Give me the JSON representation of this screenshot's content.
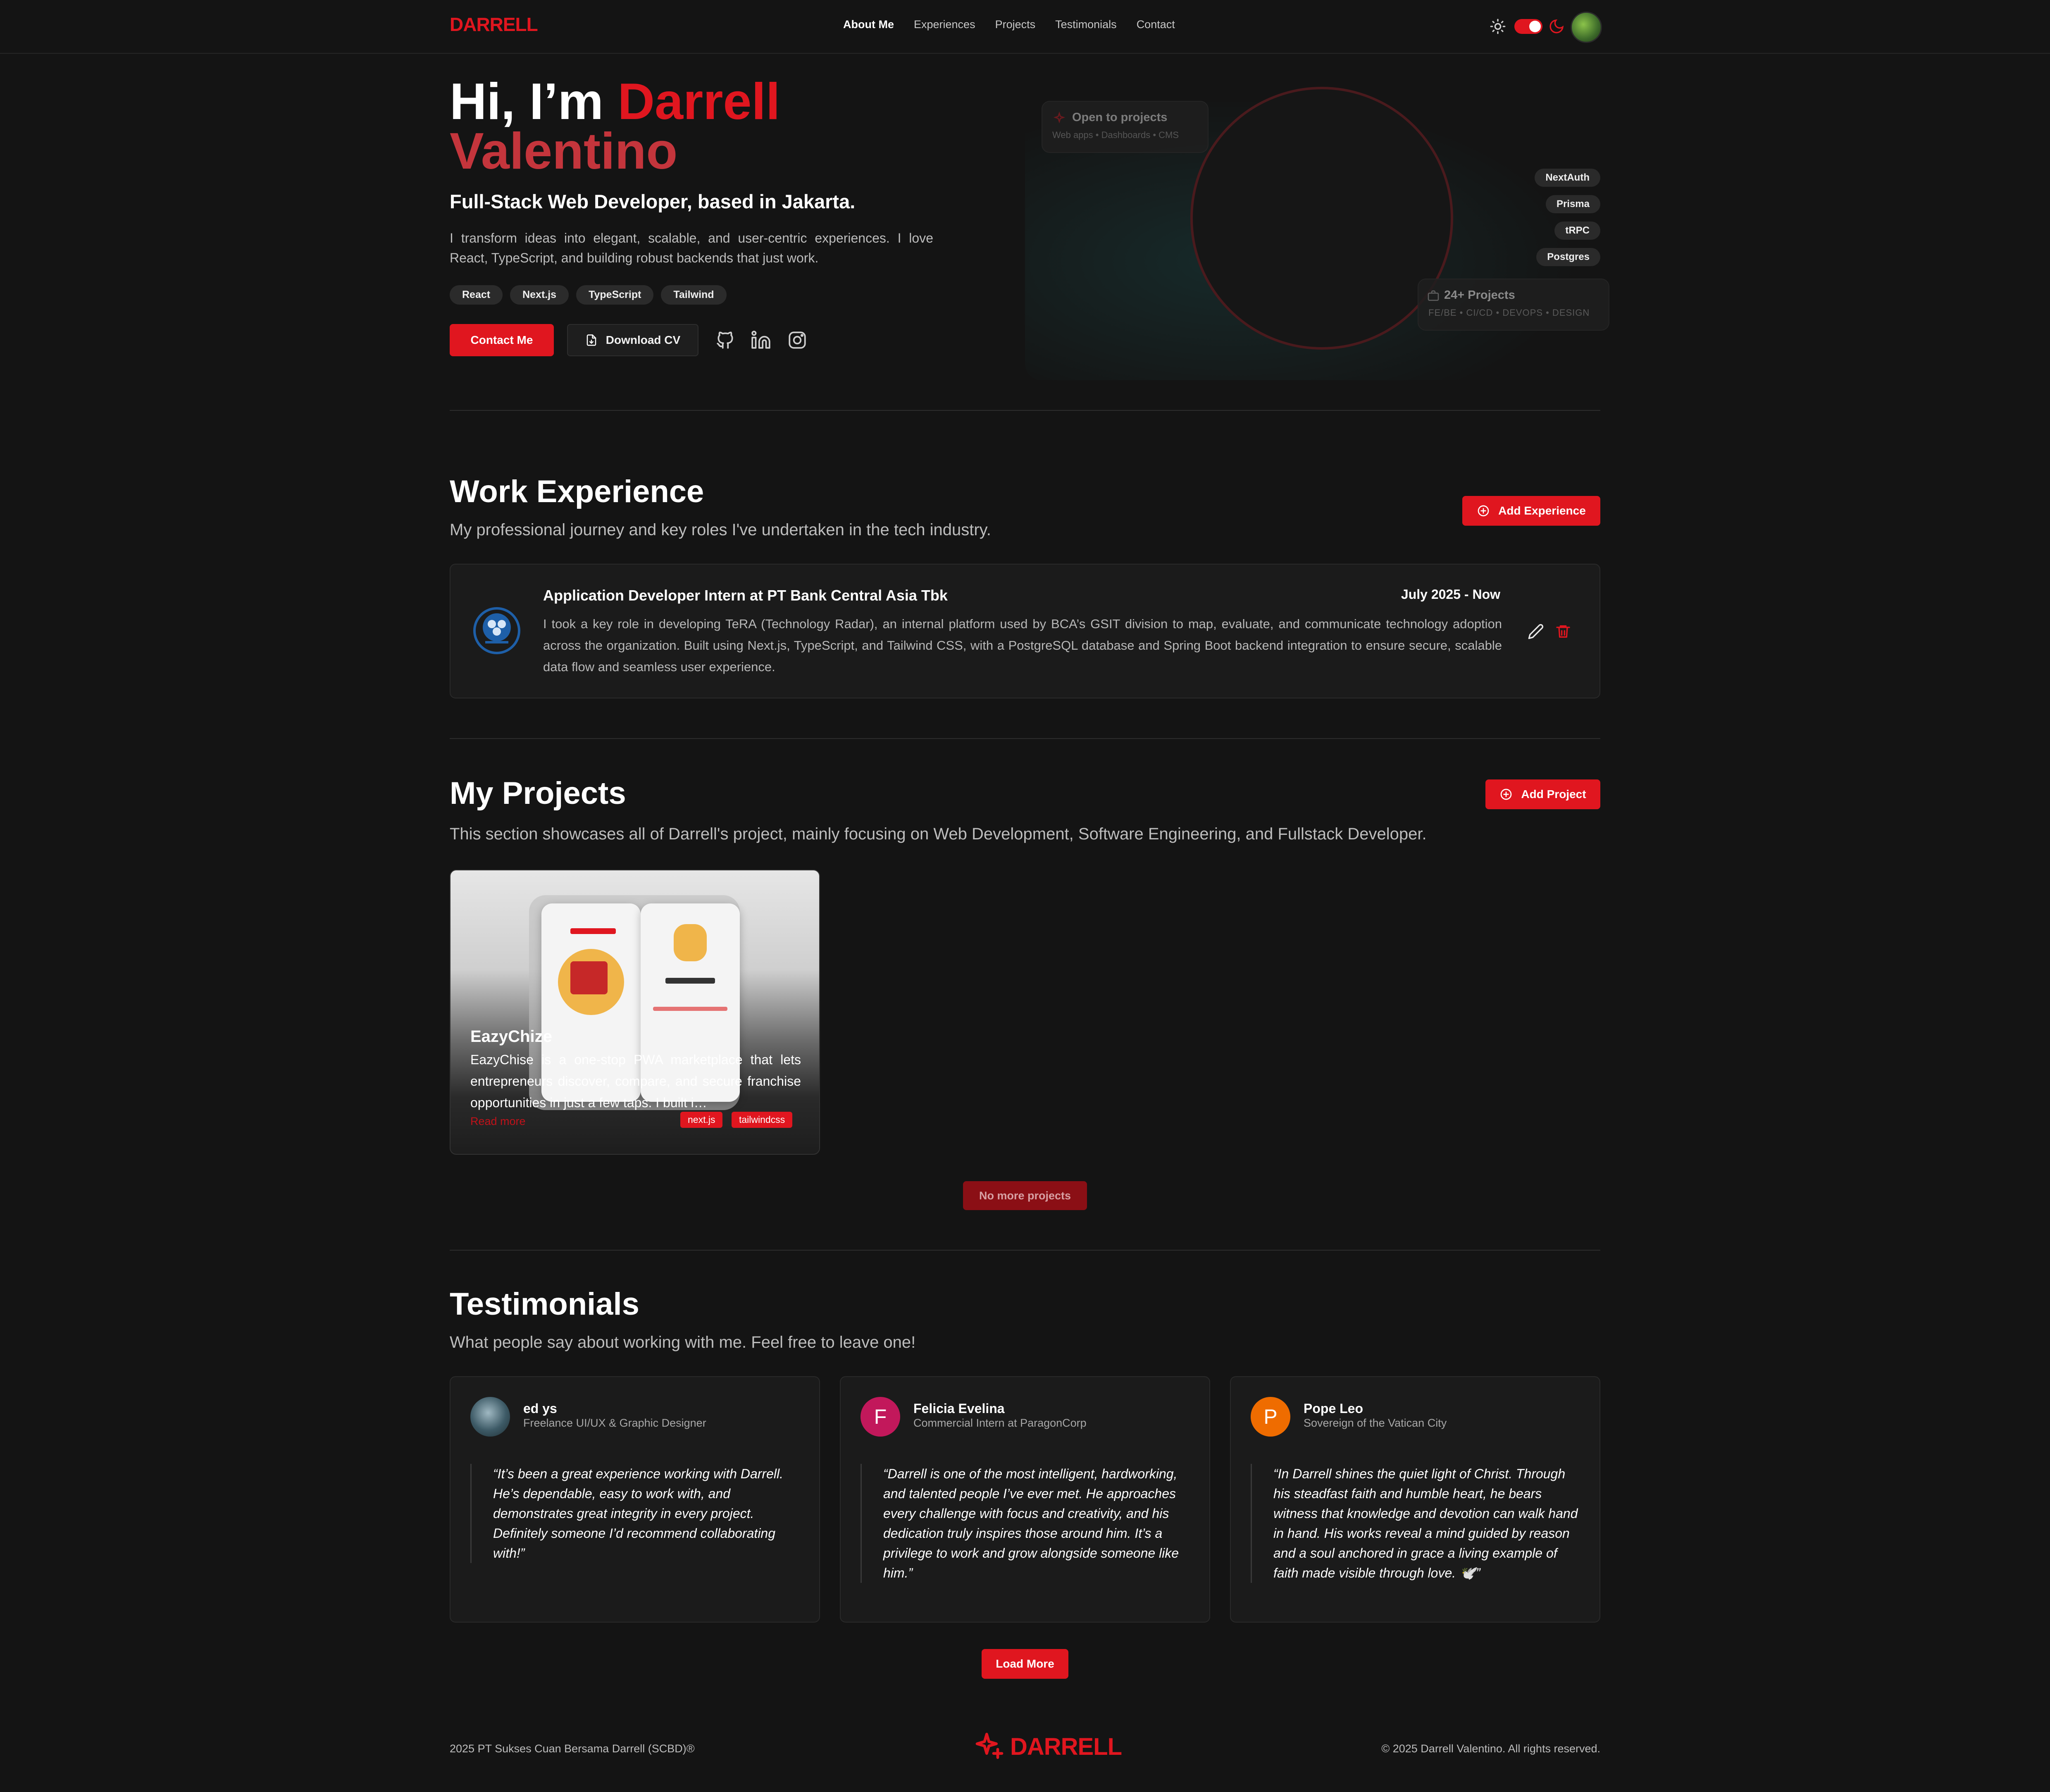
{
  "brand": {
    "logo": "DARRELL",
    "accent": "#e0161f"
  },
  "nav": {
    "items": [
      "About Me",
      "Experiences",
      "Projects",
      "Testimonials",
      "Contact"
    ],
    "active": "About Me"
  },
  "hero": {
    "greeting": "Hi, I’m",
    "first_name": "Darrell",
    "last_name": "Valentino",
    "subtitle": "Full-Stack Web Developer, based in Jakarta.",
    "description": "I transform ideas into elegant, scalable, and user-centric experiences. I love React, TypeScript, and building robust backends that just work.",
    "chips": [
      "React",
      "Next.js",
      "TypeScript",
      "Tailwind"
    ],
    "contact_label": "Contact Me",
    "cv_label": "Download CV",
    "open_card": {
      "title": "Open to projects",
      "subtitle": "Web apps • Dashboards • CMS"
    },
    "projects_card": {
      "title": "24+ Projects",
      "subtitle": "FE/BE • CI/CD • DEVOPS • DESIGN"
    },
    "side_tags": [
      "NextAuth",
      "Prisma",
      "tRPC",
      "Postgres"
    ]
  },
  "experience": {
    "title": "Work Experience",
    "subtitle": "My professional journey and key roles I've undertaken in the tech industry.",
    "add_label": "Add Experience",
    "items": [
      {
        "role": "Application Developer Intern at PT Bank Central Asia Tbk",
        "date": "July 2025 - Now",
        "description": "I took a key role in developing TeRA (Technology Radar), an internal platform used by BCA’s GSIT division to map, evaluate, and communicate technology adoption across the organization. Built using Next.js, TypeScript, and Tailwind CSS, with a PostgreSQL database and Spring Boot backend integration to ensure secure, scalable data flow and seamless user experience."
      }
    ]
  },
  "projects": {
    "title": "My Projects",
    "subtitle": "This section showcases all of Darrell's project, mainly focusing on Web Development, Software Engineering, and Fullstack Developer.",
    "add_label": "Add Project",
    "items": [
      {
        "title": "EazyChize",
        "description": "EazyChise is a one-stop PWA marketplace that lets entrepreneurs discover, compare, and secure franchise opportunities in just a few taps. I built i…",
        "read_more": "Read more",
        "tech": [
          "next.js",
          "tailwindcss"
        ]
      }
    ],
    "no_more_label": "No more projects"
  },
  "testimonials": {
    "title": "Testimonials",
    "subtitle": "What people say about working with me. Feel free to leave one!",
    "items": [
      {
        "name": "ed ys",
        "role": "Freelance UI/UX & Graphic Designer",
        "initial": "",
        "avatar_color": "#3d5a66",
        "quote": "“It’s been a great experience working with Darrell. He’s dependable, easy to work with, and demonstrates great integrity in every project. Definitely someone I’d recommend collaborating with!”"
      },
      {
        "name": "Felicia Evelina",
        "role": "Commercial Intern at ParagonCorp",
        "initial": "F",
        "avatar_color": "#c2185b",
        "quote": "“Darrell is one of the most intelligent, hardworking, and talented people I’ve ever met. He approaches every challenge with focus and creativity, and his dedication truly inspires those around him. It’s a privilege to work and grow alongside someone like him.”"
      },
      {
        "name": "Pope Leo",
        "role": "Sovereign of the Vatican City",
        "initial": "P",
        "avatar_color": "#ef6c00",
        "quote": "“In Darrell shines the quiet light of Christ. Through his steadfast faith and humble heart, he bears witness that knowledge and devotion can walk hand in hand. His works reveal a mind guided by reason and a soul anchored in grace a living example of faith made visible through love. 🕊️”"
      }
    ],
    "load_more_label": "Load More"
  },
  "footer": {
    "left": "2025 PT Sukses Cuan Bersama Darrell (SCBD)®",
    "logo": "DARRELL",
    "right": "© 2025 Darrell Valentino. All rights reserved."
  },
  "icons": {
    "theme_light": "sun-icon",
    "theme_dark": "moon-icon",
    "cv": "file-download-icon",
    "social": [
      "github-icon",
      "linkedin-icon",
      "instagram-icon"
    ],
    "add": "plus-circle-icon",
    "edit": "pencil-icon",
    "delete": "trash-icon"
  }
}
